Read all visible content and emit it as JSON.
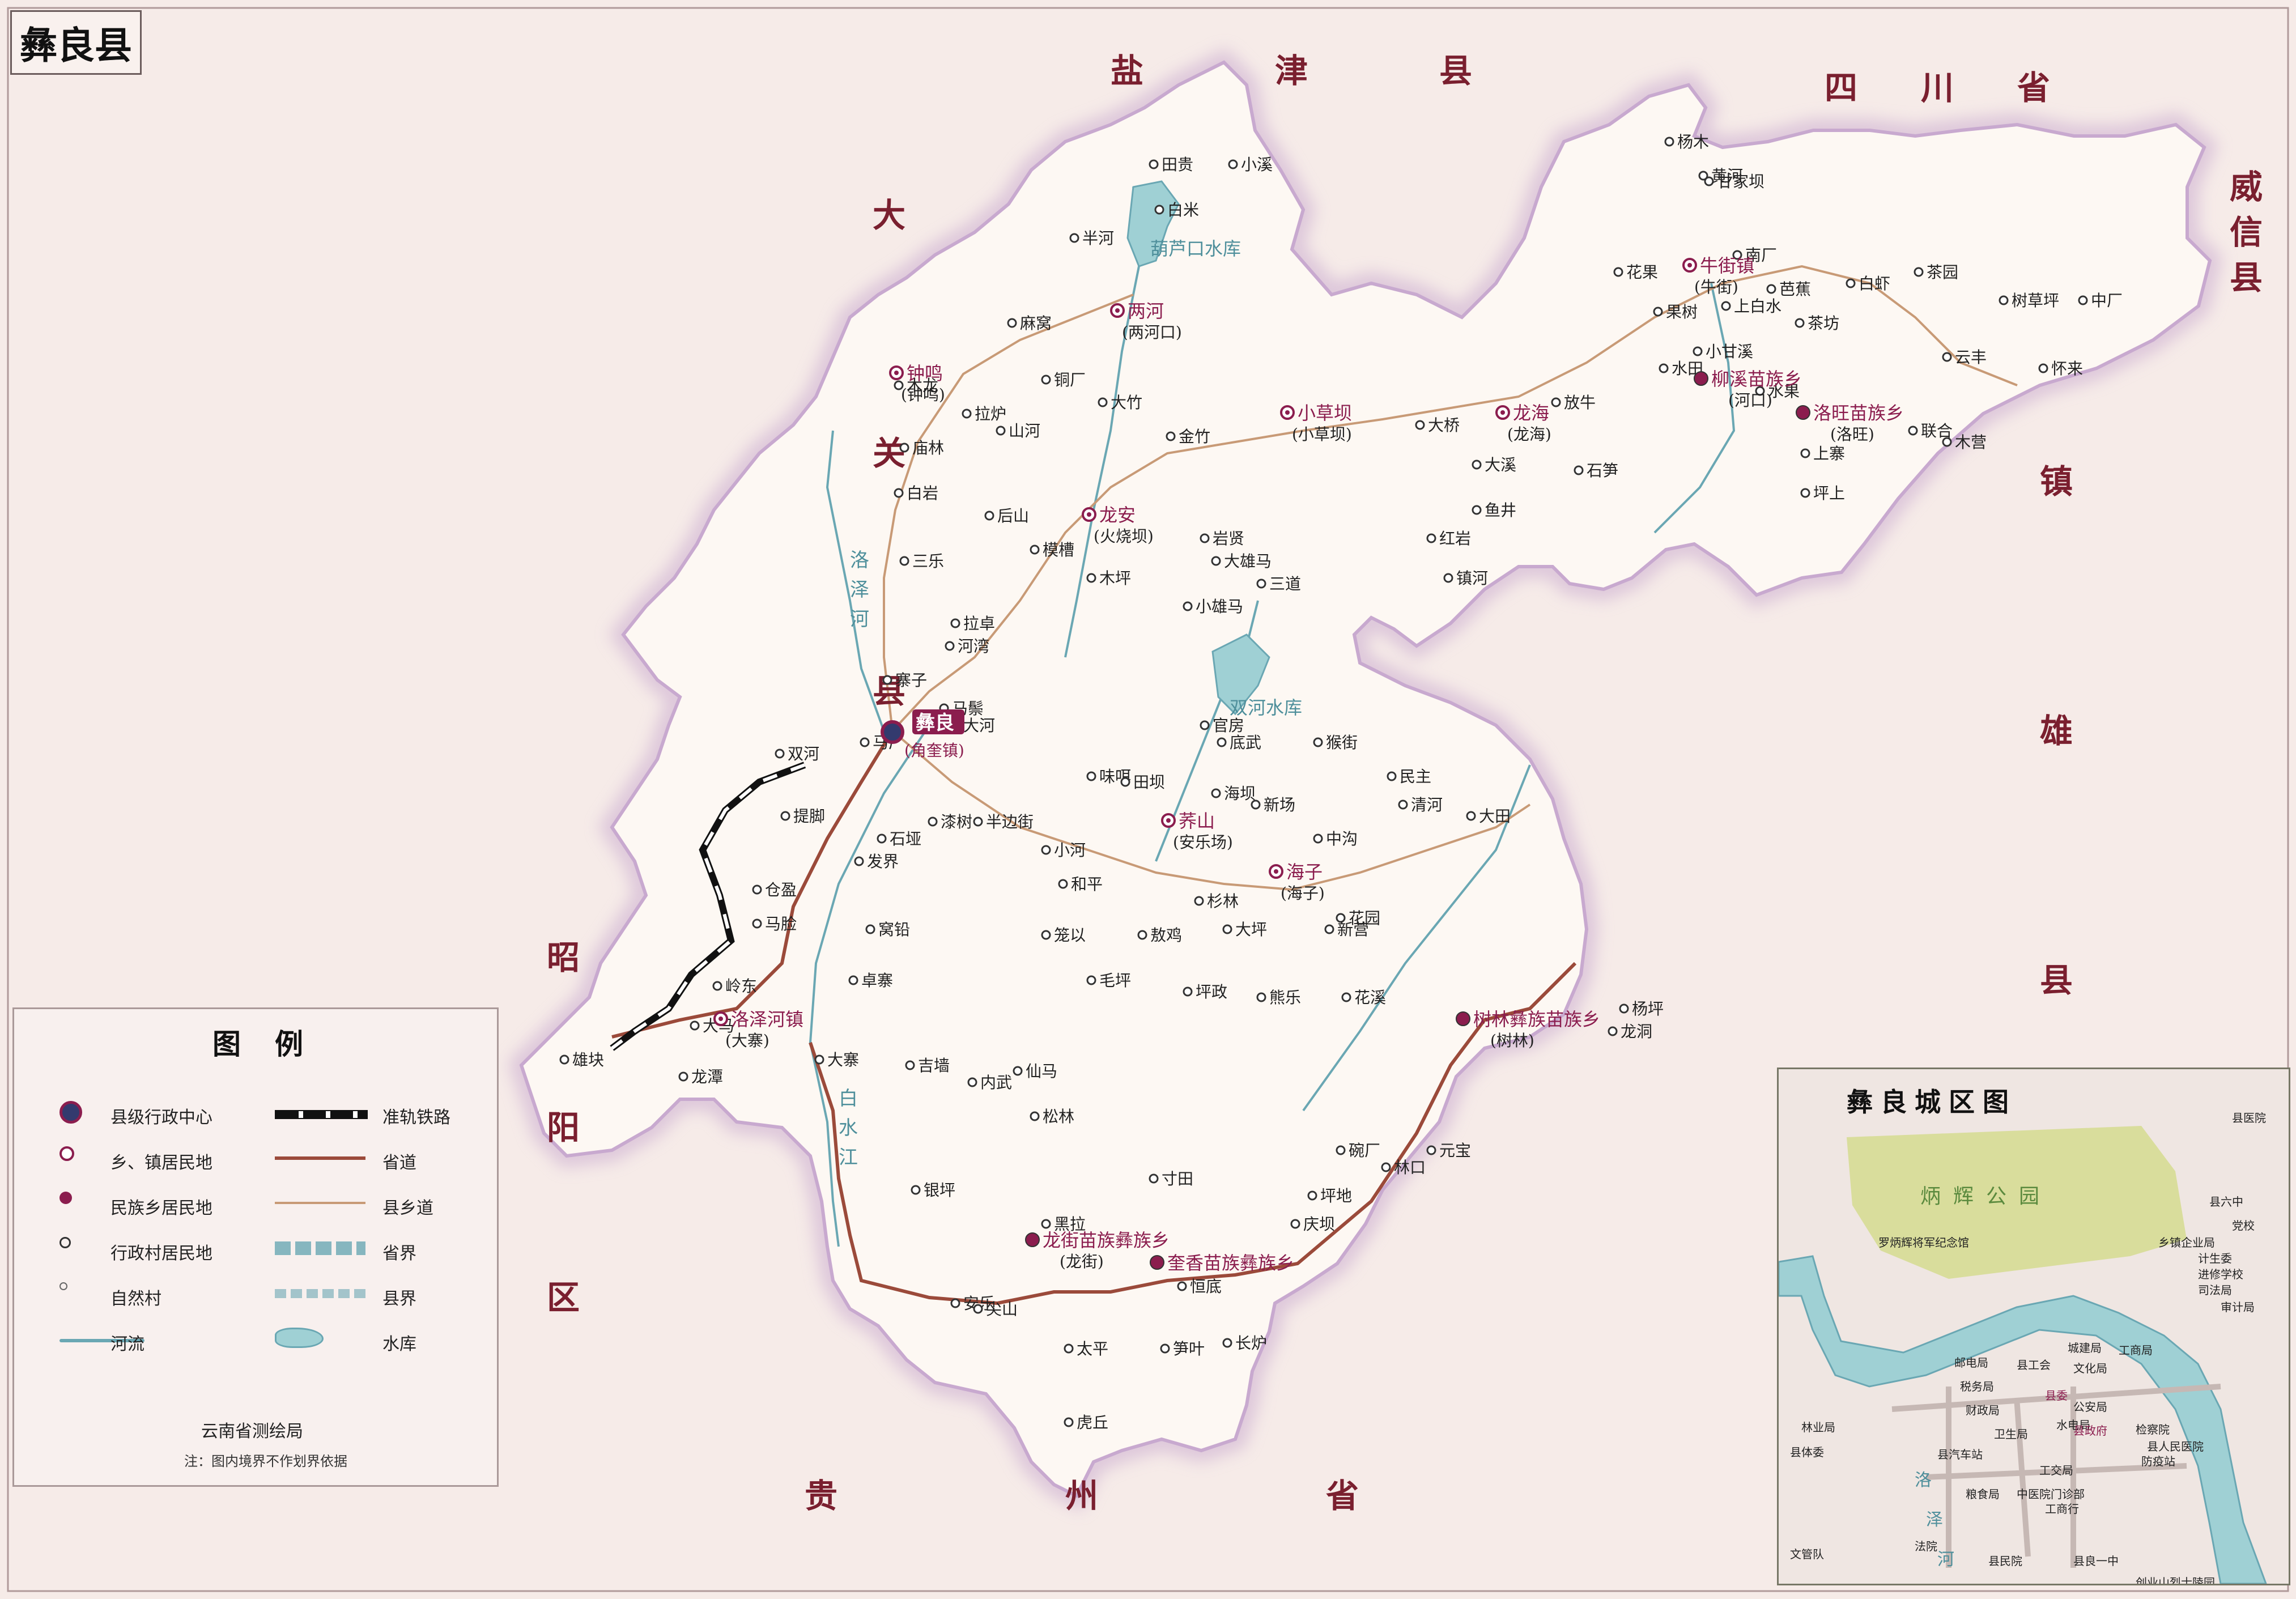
{
  "map_title": "彝良县",
  "colors": {
    "county_fill": "#fdf8f3",
    "outside_fill": "#f6ebe8",
    "border": "#c8a9cf",
    "provincial_road": "#9b4a3a",
    "county_road": "#c89a76",
    "river": "#6aa7b3",
    "reservoir": "#9fd0d4",
    "ethnic_town": "#8b1d4e",
    "railway": "#111111",
    "park": "#d9dd9c"
  },
  "neighbors": [
    {
      "text": "盐津县",
      "spaced": true
    },
    {
      "text": "四川省",
      "spaced": true
    },
    {
      "text": "威信县",
      "vertical": true
    },
    {
      "text": "镇雄县",
      "vertical": true
    },
    {
      "text": "大关县",
      "vertical": true
    },
    {
      "text": "昭阳区",
      "vertical": true
    },
    {
      "text": "贵州省",
      "spaced": true
    }
  ],
  "county_seat": {
    "name": "彝良",
    "sub": "(角奎镇)"
  },
  "towns": [
    {
      "name": "钟鸣",
      "sub": "(钟鸣)"
    },
    {
      "name": "两河",
      "sub": "(两河口)"
    },
    {
      "name": "小草坝",
      "sub": "(小草坝)"
    },
    {
      "name": "龙安",
      "sub": "(火烧坝)"
    },
    {
      "name": "龙海",
      "sub": "(龙海)"
    },
    {
      "name": "牛街镇",
      "sub": "(牛街)"
    },
    {
      "name": "荞山",
      "sub": "(安乐场)"
    },
    {
      "name": "海子",
      "sub": "(海子)"
    },
    {
      "name": "洛泽河镇",
      "sub": "(大寨)"
    }
  ],
  "ethnic_towns": [
    {
      "name": "柳溪苗族乡",
      "sub": "(河口)"
    },
    {
      "name": "洛旺苗族乡",
      "sub": "(洛旺)"
    },
    {
      "name": "树林彝族苗族乡",
      "sub": "(树林)"
    },
    {
      "name": "龙街苗族彝族乡",
      "sub": "(龙街)"
    },
    {
      "name": "奎香苗族彝族乡",
      "sub": ""
    }
  ],
  "villages": [
    "田贵",
    "小溪",
    "白米",
    "半河",
    "麻窝",
    "木龙",
    "拉炉",
    "山河",
    "庙林",
    "白岩",
    "后山",
    "三乐",
    "模槽",
    "大竹",
    "铜厂",
    "金竹",
    "大雄马",
    "小雄马",
    "木坪",
    "岩贤",
    "三道",
    "大桥",
    "放牛",
    "石笋",
    "鱼井",
    "大溪",
    "红岩",
    "镇河",
    "果树",
    "花果",
    "南厂",
    "甘家坝",
    "黄河",
    "上白水",
    "小甘溪",
    "水田",
    "水果",
    "茶坊",
    "白虾",
    "茶园",
    "树草坪",
    "中厂",
    "云丰",
    "怀来",
    "联合",
    "木营",
    "坪上",
    "上寨",
    "杨木",
    "芭蕉",
    "拉卓",
    "河湾",
    "寨子",
    "马鬃",
    "大河",
    "马厂",
    "漆树",
    "半边街",
    "石垭",
    "发界",
    "小河",
    "和平",
    "味咡",
    "田坝",
    "海坝",
    "底武",
    "官房",
    "猴街",
    "新场",
    "民主",
    "清河",
    "大田",
    "中沟",
    "花园",
    "新营",
    "杉林",
    "大坪",
    "坪政",
    "熊乐",
    "花溪",
    "毛坪",
    "敖鸡",
    "笼以",
    "窝铅",
    "卓寨",
    "吉墙",
    "内武",
    "仙马",
    "松林",
    "寸田",
    "碗厂",
    "坪地",
    "庆坝",
    "林口",
    "元宝",
    "龙洞",
    "杨坪",
    "银坪",
    "黑拉",
    "安乐",
    "尖山",
    "恒底",
    "长炉",
    "太平",
    "笋叶",
    "虎丘",
    "龙潭",
    "雄块",
    "岭东",
    "大马",
    "马脸",
    "仓盈",
    "双河",
    "提脚",
    "大寨"
  ],
  "river_labels": [
    "洛泽河",
    "白水江"
  ],
  "reservoirs": [
    "葫芦口水库",
    "双河水库"
  ],
  "legend": {
    "title": "图例",
    "items": [
      {
        "label": "县级行政中心",
        "symbol": "seat"
      },
      {
        "label": "乡、镇居民地",
        "symbol": "town"
      },
      {
        "label": "民族乡居民地",
        "symbol": "ethnic"
      },
      {
        "label": "行政村居民地",
        "symbol": "village"
      },
      {
        "label": "自然村",
        "symbol": "hamlet"
      },
      {
        "label": "河流",
        "symbol": "river"
      },
      {
        "label": "准轨铁路",
        "symbol": "railway"
      },
      {
        "label": "省道",
        "symbol": "prov-road"
      },
      {
        "label": "县乡道",
        "symbol": "county-road"
      },
      {
        "label": "省界",
        "symbol": "prov-border"
      },
      {
        "label": "县界",
        "symbol": "county-border"
      },
      {
        "label": "水库",
        "symbol": "reservoir"
      }
    ],
    "publisher": "云南省测绘局",
    "note": "注：图内境界不作划界依据"
  },
  "inset": {
    "title": "彝良城区图",
    "park": "炳辉公园",
    "river_label": "洛泽河",
    "places": [
      "罗炳辉将军纪念馆",
      "县六中",
      "党校",
      "乡镇企业局",
      "计生委",
      "进修学校",
      "司法局",
      "审计局",
      "城建局",
      "工商局",
      "邮电局",
      "县工会",
      "税务局",
      "文化局",
      "县委",
      "公安局",
      "财政局",
      "水电局",
      "县政府",
      "林业局",
      "卫生局",
      "检察院",
      "县人民医院",
      "防疫站",
      "县体委",
      "县汽车站",
      "工交局",
      "粮食局",
      "中医院门诊部",
      "工商行",
      "法院",
      "县民院",
      "文管队",
      "县良一中",
      "创业山烈士陵园",
      "县医院"
    ]
  }
}
